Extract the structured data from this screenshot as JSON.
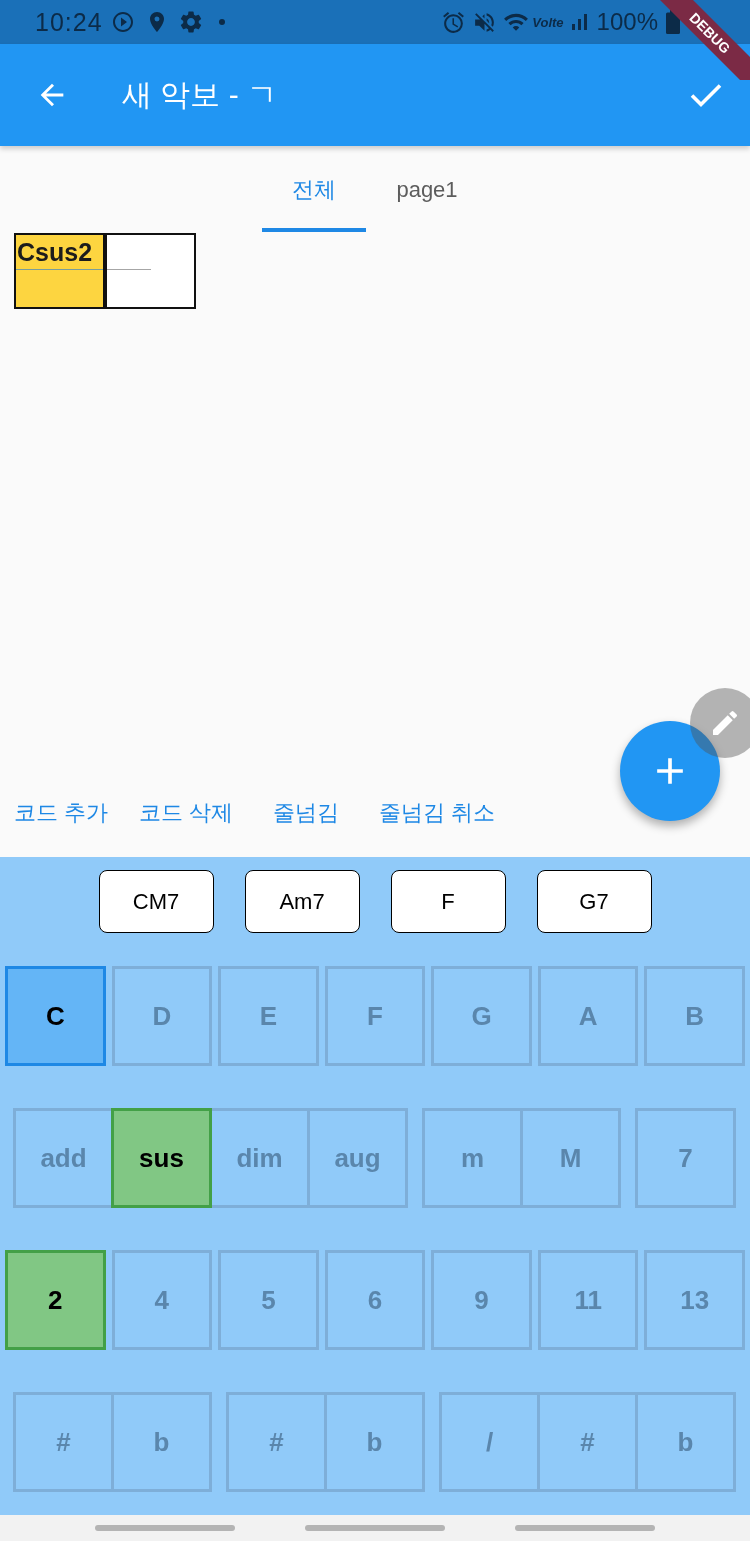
{
  "status_bar": {
    "time": "10:24",
    "network_label": "Volte",
    "battery": "100%"
  },
  "debug_banner": {
    "label": "DEBUG"
  },
  "app_bar": {
    "title": "새 악보 - ㄱ"
  },
  "tabs": [
    {
      "label": "전체",
      "selected": true
    },
    {
      "label": "page1",
      "selected": false
    }
  ],
  "measures": [
    {
      "chord": "Csus2",
      "selected": true
    },
    {
      "selected": false
    }
  ],
  "actions": [
    "코드 추가",
    "코드 삭제",
    "줄넘김",
    "줄넘김 취소"
  ],
  "keyboard": {
    "suggestions": [
      "CM7",
      "Am7",
      "F",
      "G7"
    ],
    "roots": [
      {
        "label": "C",
        "selected": true
      },
      {
        "label": "D",
        "selected": false
      },
      {
        "label": "E",
        "selected": false
      },
      {
        "label": "F",
        "selected": false
      },
      {
        "label": "G",
        "selected": false
      },
      {
        "label": "A",
        "selected": false
      },
      {
        "label": "B",
        "selected": false
      }
    ],
    "quality_groups": [
      {
        "items": [
          {
            "label": "add",
            "selected": false
          },
          {
            "label": "sus",
            "selected": true
          },
          {
            "label": "dim",
            "selected": false
          },
          {
            "label": "aug",
            "selected": false
          }
        ]
      },
      {
        "items": [
          {
            "label": "m",
            "selected": false
          },
          {
            "label": "M",
            "selected": false
          }
        ]
      },
      {
        "items": [
          {
            "label": "7",
            "selected": false
          }
        ]
      }
    ],
    "extensions": [
      {
        "label": "2",
        "selected": true
      },
      {
        "label": "4",
        "selected": false
      },
      {
        "label": "5",
        "selected": false
      },
      {
        "label": "6",
        "selected": false
      },
      {
        "label": "9",
        "selected": false
      },
      {
        "label": "11",
        "selected": false
      },
      {
        "label": "13",
        "selected": false
      }
    ],
    "accidental_groups": [
      {
        "items": [
          {
            "label": "#",
            "selected": false
          },
          {
            "label": "b",
            "selected": false
          }
        ]
      },
      {
        "items": [
          {
            "label": "#",
            "selected": false
          },
          {
            "label": "b",
            "selected": false
          }
        ]
      },
      {
        "items": [
          {
            "label": "/",
            "selected": false
          },
          {
            "label": "#",
            "selected": false
          },
          {
            "label": "b",
            "selected": false
          }
        ]
      }
    ]
  }
}
